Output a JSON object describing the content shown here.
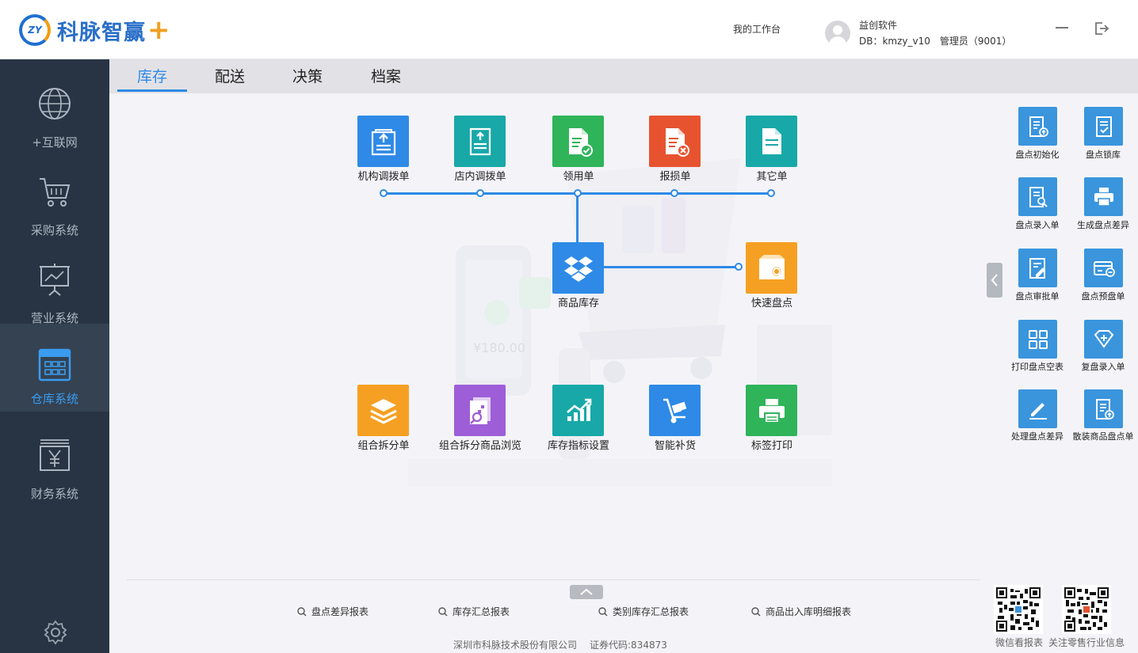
{
  "app": {
    "logo_badge": "ZY",
    "logo_text": "科脉智赢",
    "logo_plus": "+"
  },
  "header": {
    "workbench": "我的工作台",
    "user_name": "益创软件",
    "db_info": "DB：kmzy_v10　管理员（9001）"
  },
  "sidebar": {
    "items": [
      {
        "label": "+互联网",
        "icon": "globe-icon"
      },
      {
        "label": "采购系统",
        "icon": "cart-icon"
      },
      {
        "label": "营业系统",
        "icon": "presentation-icon"
      },
      {
        "label": "仓库系统",
        "icon": "warehouse-icon"
      },
      {
        "label": "财务系统",
        "icon": "yuan-icon"
      }
    ],
    "active": "仓库系统"
  },
  "tabs": [
    {
      "label": "库存"
    },
    {
      "label": "配送"
    },
    {
      "label": "决策"
    },
    {
      "label": "档案"
    }
  ],
  "main": {
    "top_items": [
      {
        "label": "机构调拨单",
        "color": "#2e8ae6"
      },
      {
        "label": "店内调拨单",
        "color": "#18a8a8"
      },
      {
        "label": "领用单",
        "color": "#2fb45a"
      },
      {
        "label": "报损单",
        "color": "#e7532f"
      },
      {
        "label": "其它单",
        "color": "#18a8a8"
      }
    ],
    "center_item": {
      "label": "商品库存",
      "color": "#2e8ae6"
    },
    "quick_item": {
      "label": "快速盘点",
      "color": "#f6a023"
    },
    "bottom_items": [
      {
        "label": "组合拆分单",
        "color": "#f6a023"
      },
      {
        "label": "组合拆分商品浏览",
        "color": "#9d5ed8"
      },
      {
        "label": "库存指标设置",
        "color": "#18a8a8"
      },
      {
        "label": "智能补货",
        "color": "#2e8ae6"
      },
      {
        "label": "标签打印",
        "color": "#2fb45a"
      }
    ]
  },
  "right_panel": {
    "items": [
      {
        "label": "盘点初始化"
      },
      {
        "label": "盘点锁库"
      },
      {
        "label": "盘点录入单"
      },
      {
        "label": "生成盘点差异"
      },
      {
        "label": "盘点审批单"
      },
      {
        "label": "盘点预盘单"
      },
      {
        "label": "打印盘点空表"
      },
      {
        "label": "复盘录入单"
      },
      {
        "label": "处理盘点差异"
      },
      {
        "label": "散装商品盘点单"
      }
    ]
  },
  "reports": [
    {
      "label": "盘点差异报表"
    },
    {
      "label": "库存汇总报表"
    },
    {
      "label": "类别库存汇总报表"
    },
    {
      "label": "商品出入库明细报表"
    }
  ],
  "footer": {
    "company": "深圳市科脉技术股份有限公司",
    "stock_code": "证券代码:834873",
    "qr_left_label": "微信看报表",
    "qr_right_label": "关注零售行业信息"
  }
}
